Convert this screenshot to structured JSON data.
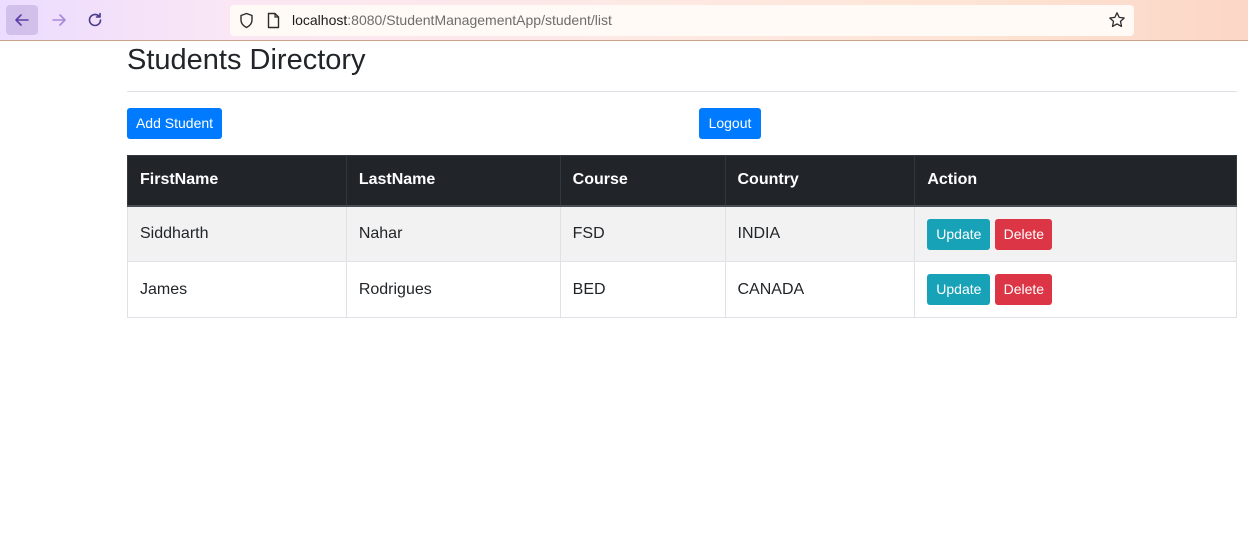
{
  "browser": {
    "url_host": "localhost",
    "url_rest": ":8080/StudentManagementApp/student/list"
  },
  "page": {
    "title": "Students Directory",
    "add_button": "Add Student",
    "logout_button": "Logout"
  },
  "table": {
    "headers": [
      "FirstName",
      "LastName",
      "Course",
      "Country",
      "Action"
    ],
    "rows": [
      {
        "first": "Siddharth",
        "last": "Nahar",
        "course": "FSD",
        "country": "INDIA",
        "update": "Update",
        "delete": "Delete"
      },
      {
        "first": "James",
        "last": "Rodrigues",
        "course": "BED",
        "country": "CANADA",
        "update": "Update",
        "delete": "Delete"
      }
    ]
  },
  "colors": {
    "primary": "#007bff",
    "info": "#17a2b8",
    "danger": "#dc3545",
    "table_header": "#212529"
  },
  "icons": [
    "back-arrow-icon",
    "forward-arrow-icon",
    "reload-icon",
    "shield-icon",
    "page-icon",
    "star-icon"
  ]
}
